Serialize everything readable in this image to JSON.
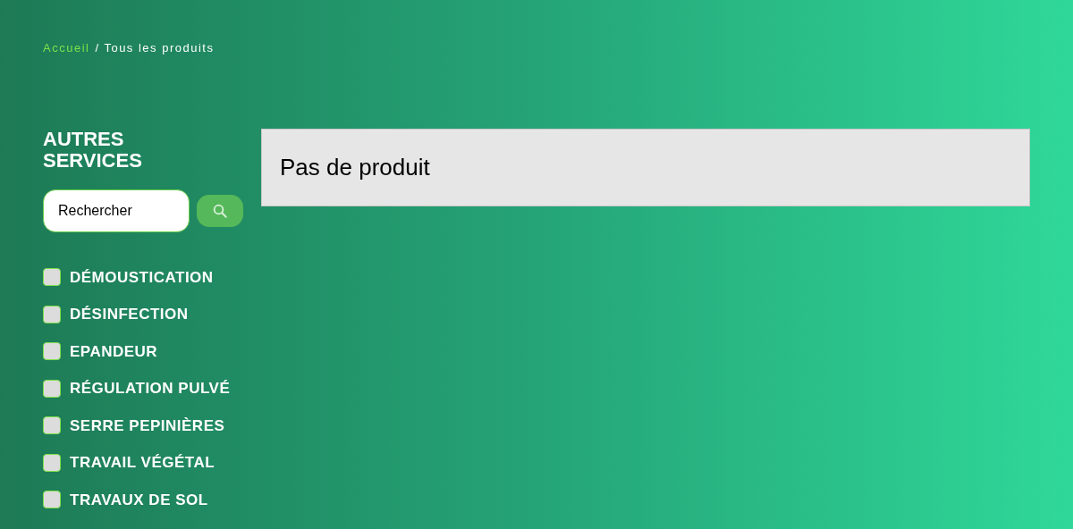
{
  "breadcrumb": [
    {
      "label": "Accueil",
      "kind": "link"
    },
    {
      "label": "/ Tous les produits",
      "kind": "current"
    }
  ],
  "sidebar": {
    "title": "AUTRES SERVICES",
    "search": {
      "value": "Rechercher"
    },
    "filters": [
      {
        "label": "DÉMOUSTICATION",
        "checked": false
      },
      {
        "label": "DÉSINFECTION",
        "checked": false
      },
      {
        "label": "EPANDEUR",
        "checked": false
      },
      {
        "label": "RÉGULATION PULVÉ",
        "checked": false
      },
      {
        "label": "SERRE PEPINIÈRES",
        "checked": false
      },
      {
        "label": "TRAVAIL VÉGÉTAL",
        "checked": false
      },
      {
        "label": "TRAVAUX DE SOL",
        "checked": false
      }
    ]
  },
  "results": {
    "message": "Pas de produit"
  }
}
